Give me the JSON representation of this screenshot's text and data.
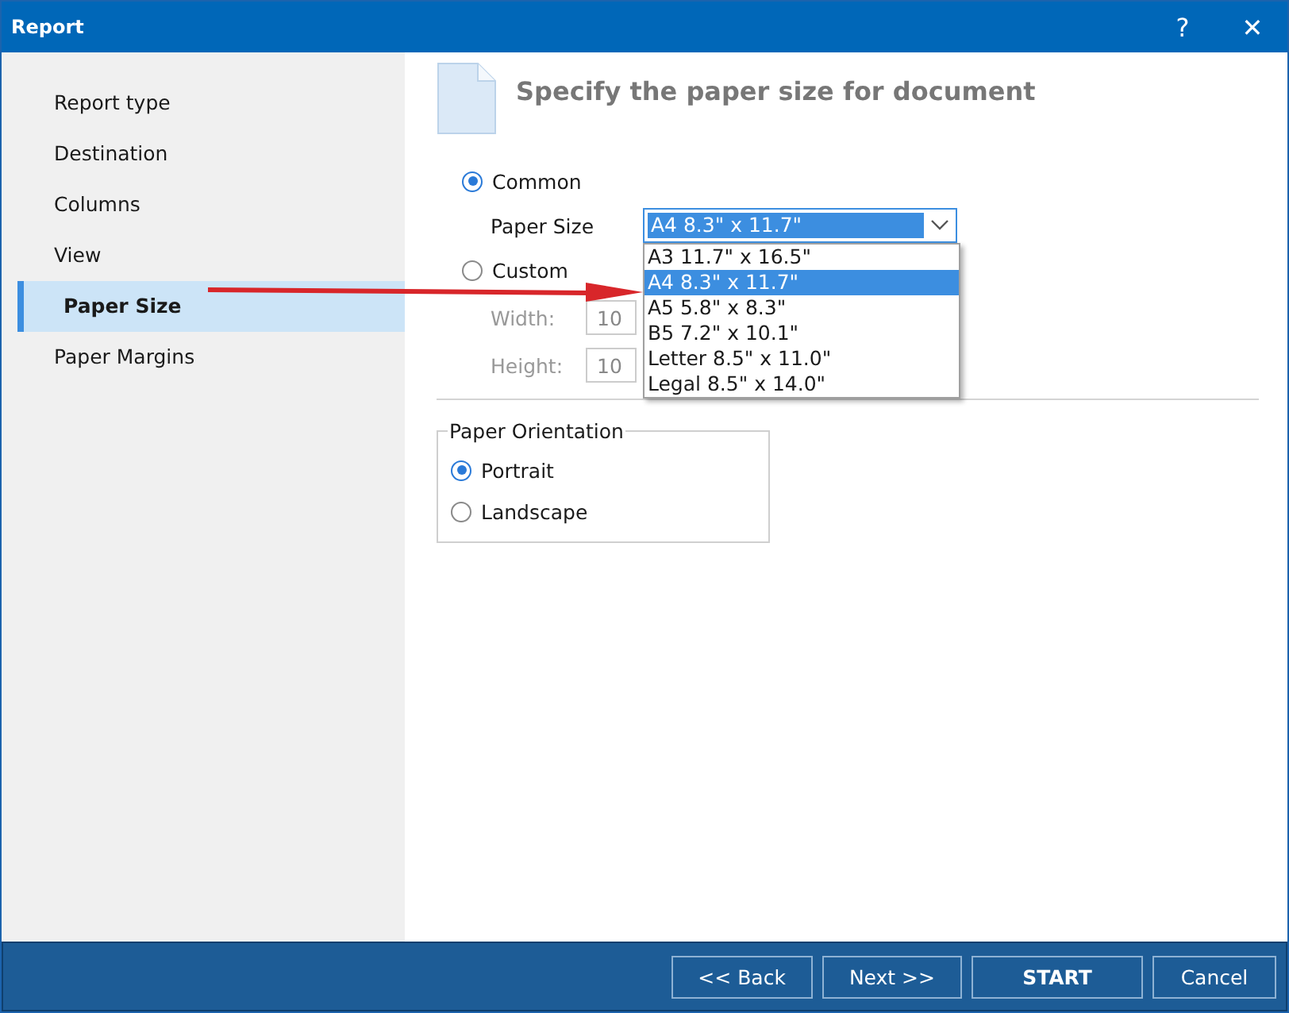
{
  "window": {
    "title": "Report",
    "help": "?",
    "close": "✕"
  },
  "sidebar": {
    "items": [
      {
        "label": "Report type",
        "selected": false
      },
      {
        "label": "Destination",
        "selected": false
      },
      {
        "label": "Columns",
        "selected": false
      },
      {
        "label": "View",
        "selected": false
      },
      {
        "label": "Paper Size",
        "selected": true
      },
      {
        "label": "Paper Margins",
        "selected": false
      }
    ]
  },
  "header": {
    "title": "Specify the paper size for document"
  },
  "size_mode": [
    {
      "label": "Common",
      "selected": true
    },
    {
      "label": "Custom",
      "selected": false
    }
  ],
  "paper_size": {
    "label": "Paper Size",
    "value": "A4 8.3\" x 11.7\"",
    "expanded": true,
    "options": [
      {
        "label": "A3 11.7\" x 16.5\"",
        "selected": false
      },
      {
        "label": "A4 8.3\" x 11.7\"",
        "selected": true
      },
      {
        "label": "A5 5.8\" x 8.3\"",
        "selected": false
      },
      {
        "label": "B5 7.2\" x 10.1\"",
        "selected": false
      },
      {
        "label": "Letter 8.5\" x 11.0\"",
        "selected": false
      },
      {
        "label": "Legal 8.5\" x 14.0\"",
        "selected": false
      }
    ]
  },
  "custom_fields": [
    {
      "label": "Width:",
      "value": "10",
      "disabled": true
    },
    {
      "label": "Height:",
      "value": "10",
      "disabled": true
    }
  ],
  "orientation": {
    "title": "Paper Orientation",
    "options": [
      {
        "label": "Portrait",
        "selected": true
      },
      {
        "label": "Landscape",
        "selected": false
      }
    ]
  },
  "buttons": [
    {
      "label": "<< Back"
    },
    {
      "label": "Next >>"
    },
    {
      "label": "START",
      "bold": true
    },
    {
      "label": "Cancel"
    }
  ]
}
